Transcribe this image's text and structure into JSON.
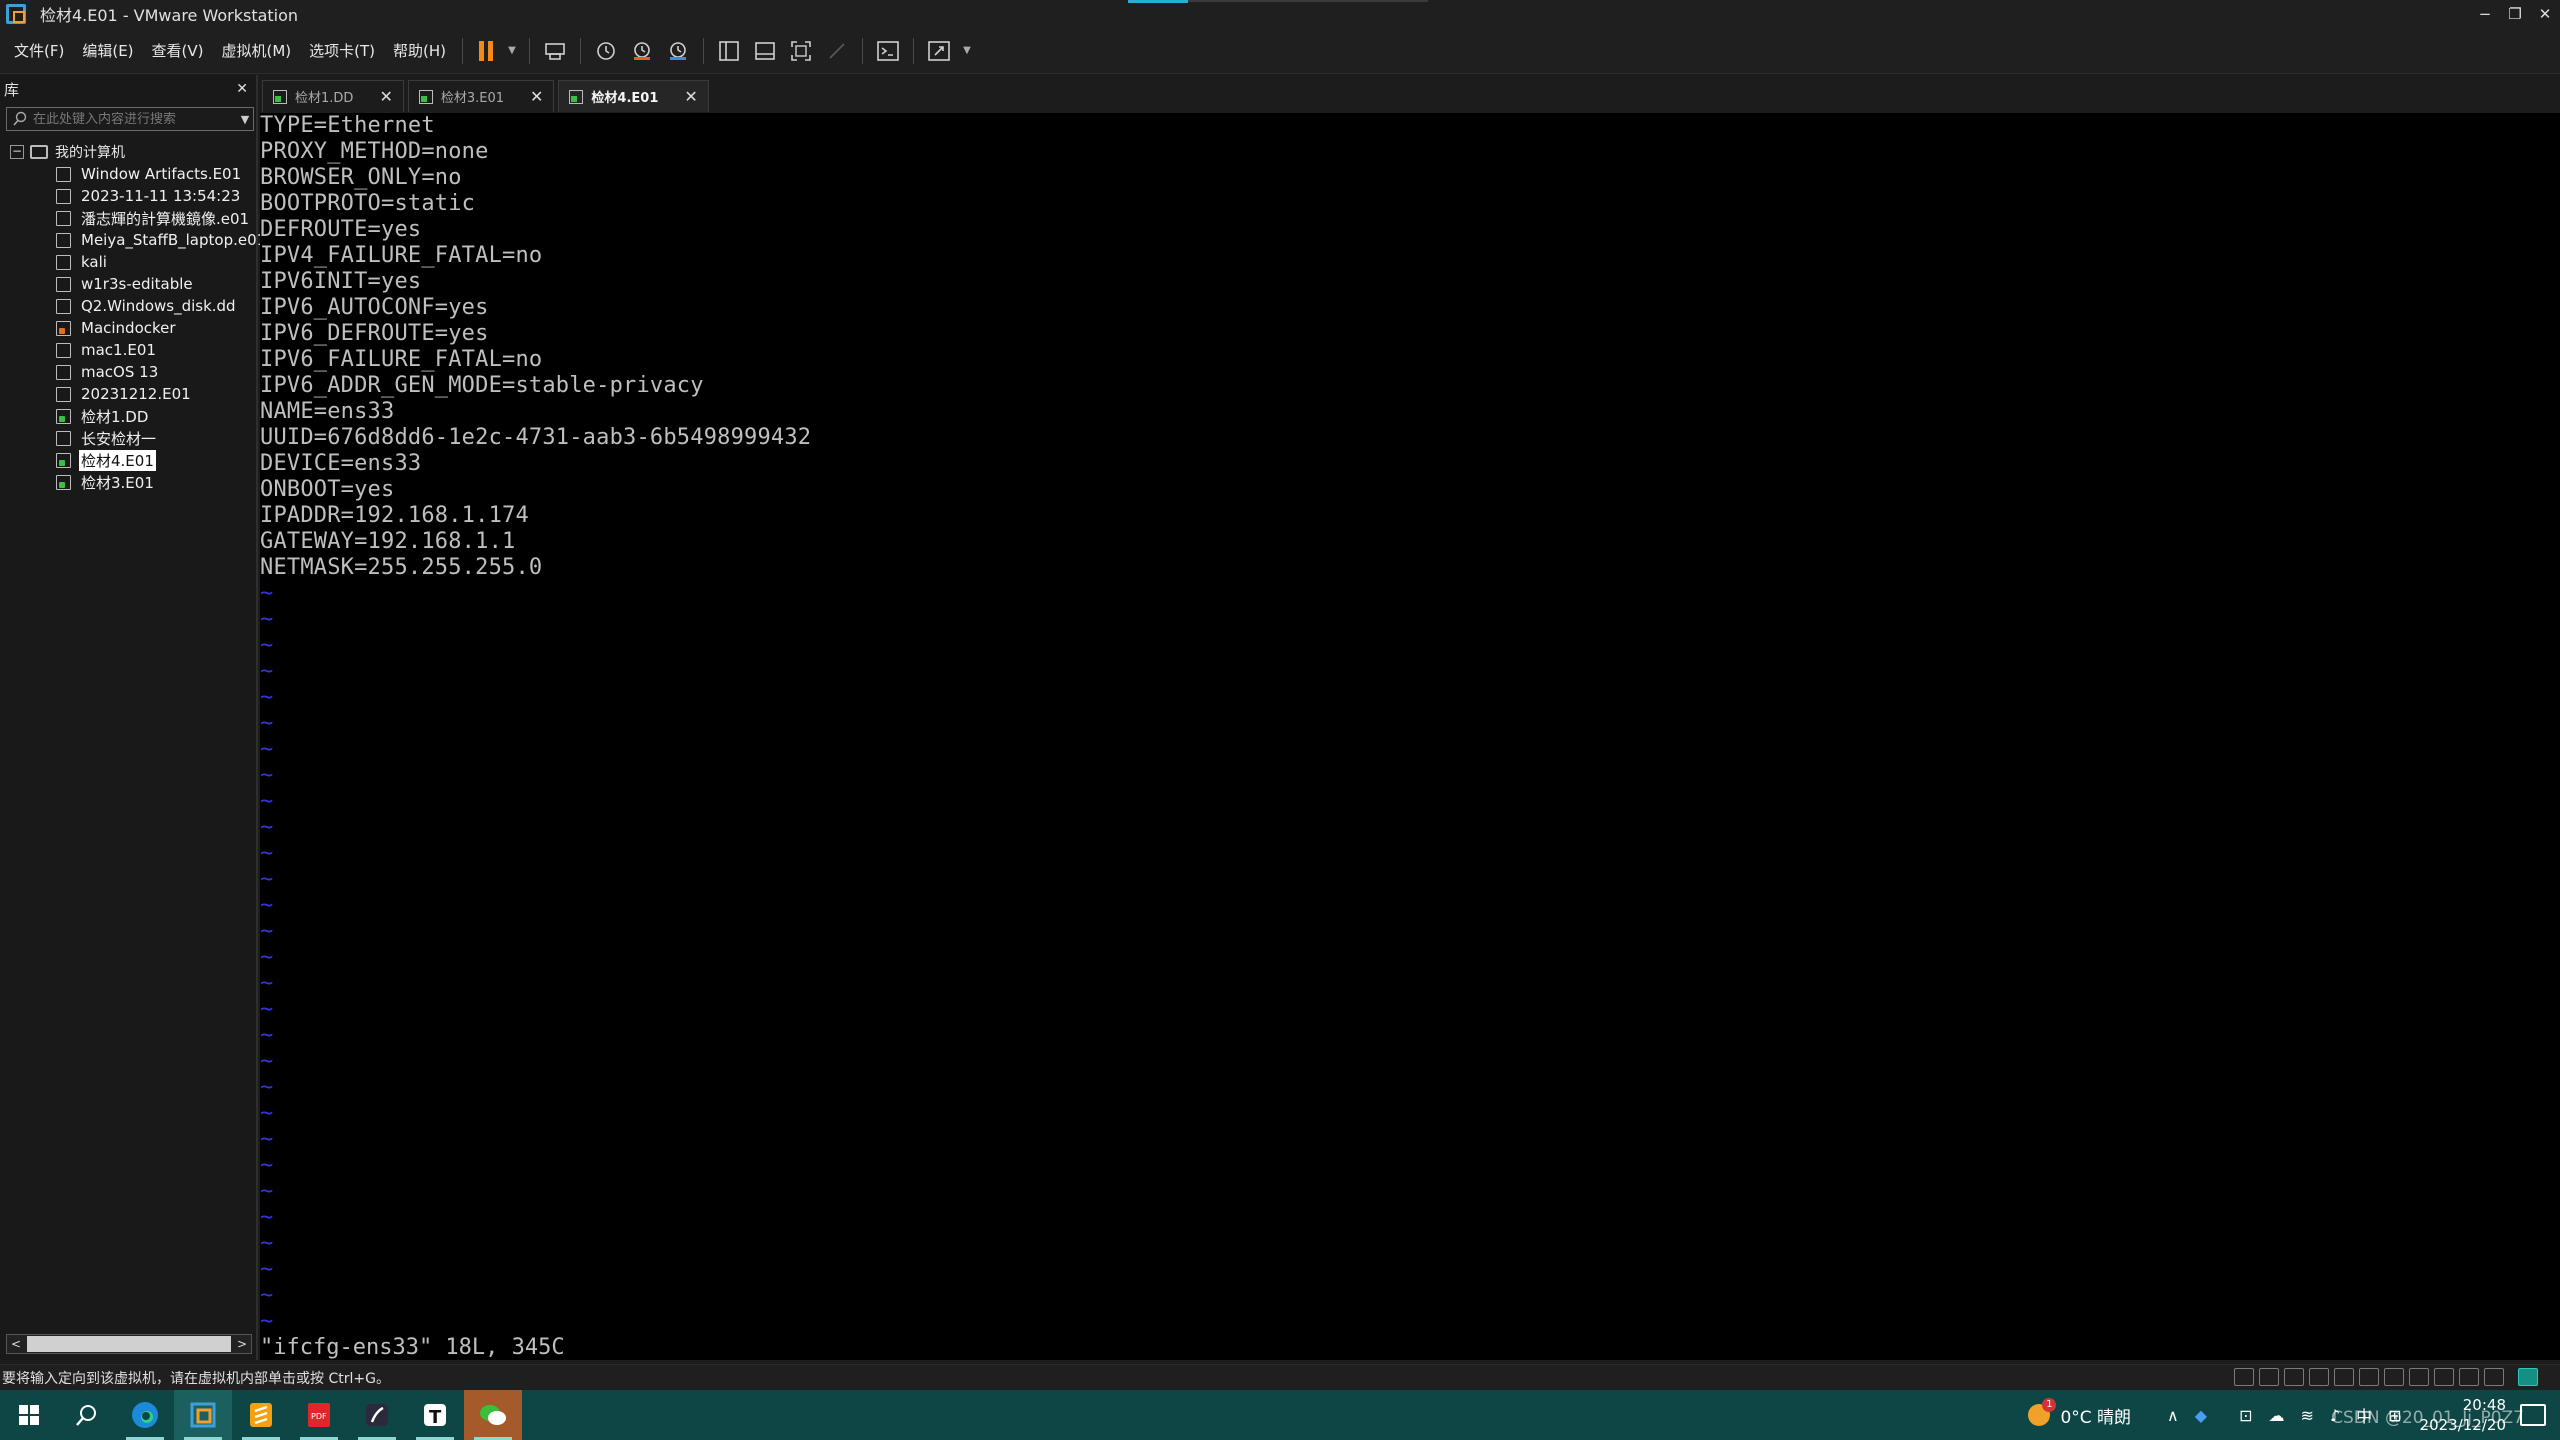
{
  "window": {
    "title": "检材4.E01 - VMware Workstation",
    "controls": {
      "minimize": "−",
      "restore": "❐",
      "close": "✕"
    }
  },
  "menu": [
    "文件(F)",
    "编辑(E)",
    "查看(V)",
    "虚拟机(M)",
    "选项卡(T)",
    "帮助(H)"
  ],
  "toolbar": {
    "icons": [
      "pause-icon",
      "send-ctrl-alt-del-icon",
      "snapshot-icon",
      "revert-snapshot-icon",
      "snapshot-manager-icon",
      "show-library-icon",
      "thumbnail-bar-icon",
      "full-screen-icon",
      "unity-icon",
      "console-view-icon",
      "stretch-view-icon"
    ]
  },
  "library": {
    "title": "库",
    "close": "✕",
    "search_placeholder": "在此处键入内容进行搜索",
    "root": "我的计算机",
    "items": [
      {
        "label": "Window Artifacts.E01",
        "state": "off"
      },
      {
        "label": "2023-11-11 13:54:23",
        "state": "off"
      },
      {
        "label": "潘志輝的計算機鏡像.e01",
        "state": "off"
      },
      {
        "label": "Meiya_StaffB_laptop.e01",
        "state": "off"
      },
      {
        "label": "kali",
        "state": "off"
      },
      {
        "label": "w1r3s-editable",
        "state": "off"
      },
      {
        "label": "Q2.Windows_disk.dd",
        "state": "off"
      },
      {
        "label": "Macindocker",
        "state": "warn"
      },
      {
        "label": "mac1.E01",
        "state": "off"
      },
      {
        "label": "macOS 13",
        "state": "off"
      },
      {
        "label": "20231212.E01",
        "state": "off"
      },
      {
        "label": "检材1.DD",
        "state": "run"
      },
      {
        "label": "长安检材一",
        "state": "off"
      },
      {
        "label": "检材4.E01",
        "state": "run",
        "selected": true
      },
      {
        "label": "检材3.E01",
        "state": "run"
      }
    ],
    "scroll_left": "<",
    "scroll_right": ">"
  },
  "tabs": [
    {
      "label": "检材1.DD",
      "active": false,
      "close": "✕"
    },
    {
      "label": "检材3.E01",
      "active": false,
      "close": "✕"
    },
    {
      "label": "检材4.E01",
      "active": true,
      "close": "✕"
    }
  ],
  "console": {
    "lines": [
      "TYPE=Ethernet",
      "PROXY_METHOD=none",
      "BROWSER_ONLY=no",
      "BOOTPROTO=static",
      "DEFROUTE=yes",
      "IPV4_FAILURE_FATAL=no",
      "IPV6INIT=yes",
      "IPV6_AUTOCONF=yes",
      "IPV6_DEFROUTE=yes",
      "IPV6_FAILURE_FATAL=no",
      "IPV6_ADDR_GEN_MODE=stable-privacy",
      "NAME=ens33",
      "UUID=676d8dd6-1e2c-4731-aab3-6b5498999432",
      "DEVICE=ens33",
      "ONBOOT=yes",
      "IPADDR=192.168.1.174",
      "GATEWAY=192.168.1.1",
      "NETMASK=255.255.255.0"
    ],
    "tilde": "~",
    "tilde_count": 29,
    "status": "\"ifcfg-ens33\" 18L, 345C",
    "colors": {
      "text": "#bfbfbf",
      "tilde": "#3636d8",
      "background": "#000000"
    }
  },
  "statusbar": {
    "hint": "要将输入定向到该虚拟机，请在虚拟机内部单击或按 Ctrl+G。"
  },
  "taskbar": {
    "apps": [
      "windows-start-icon",
      "search-icon",
      "edge-icon",
      "vmware-icon",
      "sublime-icon",
      "pdf-icon",
      "typora-icon",
      "typora-t-icon",
      "wechat-icon"
    ],
    "weather": "0°C  晴朗",
    "ime": "中",
    "time": "20:48",
    "date": "2023/12/20"
  },
  "watermark": "CSDN @20_01_Jj_P0Z7"
}
